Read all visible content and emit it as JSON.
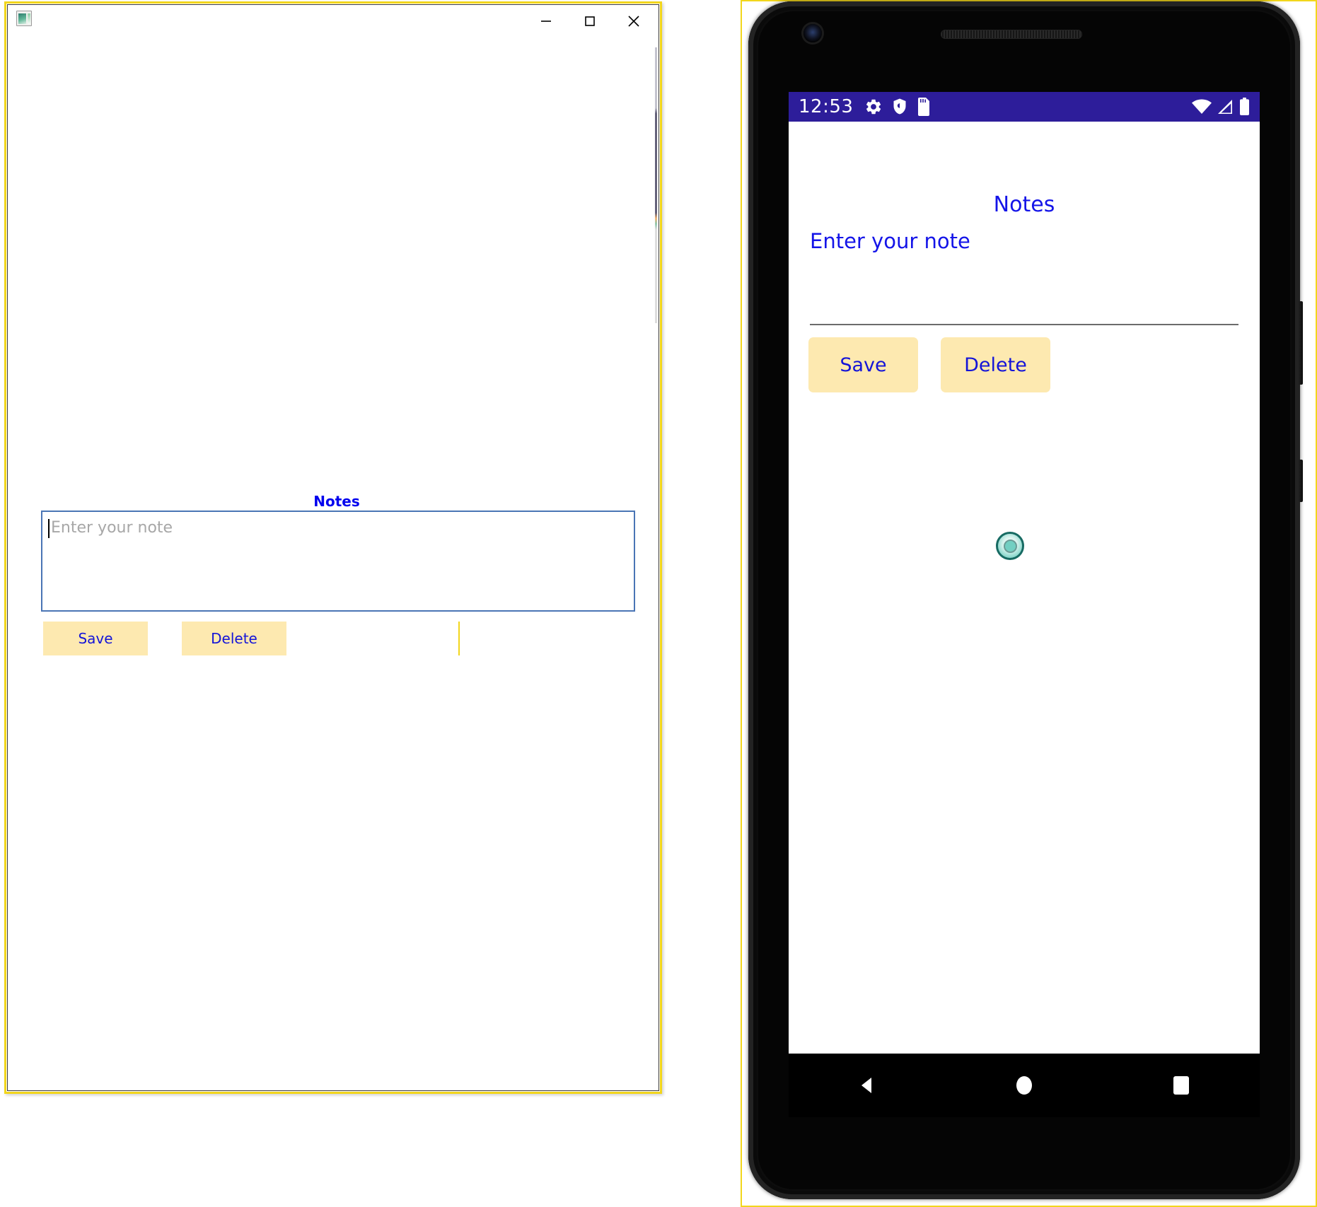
{
  "desktop": {
    "window_title": "",
    "app_icon": "app-window-icon",
    "controls": {
      "minimize": "minimize-icon",
      "maximize": "maximize-icon",
      "close": "close-icon"
    },
    "notes_title": "Notes",
    "note_input": {
      "value": "",
      "placeholder": "Enter your note"
    },
    "save_label": "Save",
    "delete_label": "Delete",
    "border_color": "#f2d61c",
    "button_bg": "#fde9b0",
    "button_text_color": "#1414d8",
    "title_color": "#0000ee"
  },
  "phone": {
    "status_bar": {
      "time": "12:53",
      "left_icons": [
        "gear-icon",
        "shield-icon",
        "sd-card-icon"
      ],
      "right_icons": [
        "wifi-icon",
        "cellular-signal-icon",
        "battery-icon"
      ],
      "background_color": "#2d1d9a"
    },
    "app": {
      "notes_title": "Notes",
      "field_label": "Enter your note",
      "note_input": {
        "value": "",
        "placeholder": ""
      },
      "save_label": "Save",
      "delete_label": "Delete",
      "touch_indicator": "touch-pointer-icon",
      "title_color": "#1414e8",
      "button_bg": "#fde9b0"
    },
    "nav_bar": {
      "back": "back-triangle-icon",
      "home": "home-circle-icon",
      "recents": "recents-square-icon"
    },
    "frame_border_color": "#f2d61c"
  }
}
